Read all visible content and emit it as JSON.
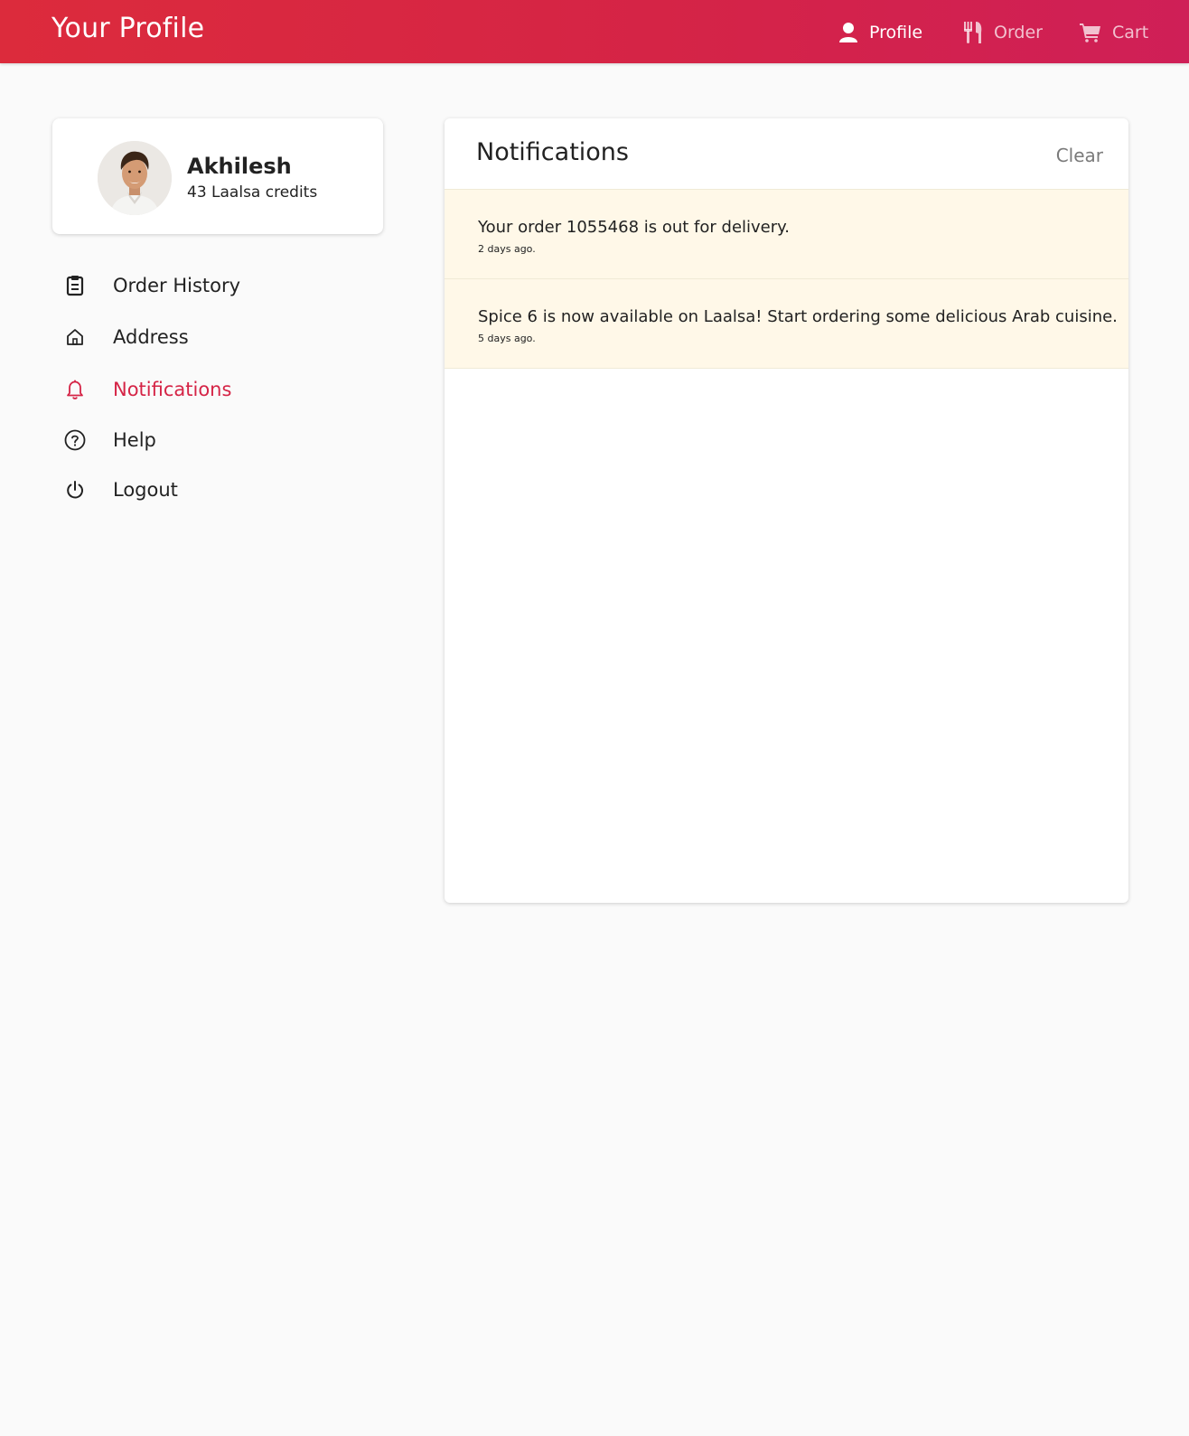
{
  "header": {
    "title": "Your Profile",
    "nav": {
      "profile": "Profile",
      "order": "Order",
      "cart": "Cart"
    },
    "gradient_colors": [
      "#dc2b3c",
      "#cf1f57"
    ]
  },
  "user": {
    "name": "Akhilesh",
    "credits": "43 Laalsa credits"
  },
  "sidebar": {
    "items": [
      {
        "label": "Order History",
        "icon": "clipboard-icon"
      },
      {
        "label": "Address",
        "icon": "home-icon"
      },
      {
        "label": "Notifications",
        "icon": "bell-icon",
        "active": true
      },
      {
        "label": "Help",
        "icon": "help-circle-icon"
      },
      {
        "label": "Logout",
        "icon": "power-icon"
      }
    ],
    "active_color": "#d52446"
  },
  "notifications": {
    "title": "Notifications",
    "clear_label": "Clear",
    "items": [
      {
        "text": "Your order 1055468 is out for delivery.",
        "time": "2 days ago."
      },
      {
        "text": "Spice 6 is now available on Laalsa! Start ordering some delicious Arab cuisine.",
        "time": "5 days ago."
      }
    ],
    "highlight_color": "#fff8e8"
  }
}
